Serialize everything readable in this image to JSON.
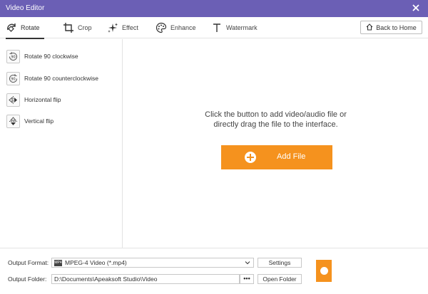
{
  "window": {
    "title": "Video Editor"
  },
  "tabs": [
    {
      "label": "Rotate",
      "icon": "rotate-icon",
      "active": true
    },
    {
      "label": "Crop",
      "icon": "crop-icon",
      "active": false
    },
    {
      "label": "Effect",
      "icon": "effect-sparkle-icon",
      "active": false
    },
    {
      "label": "Enhance",
      "icon": "enhance-palette-icon",
      "active": false
    },
    {
      "label": "Watermark",
      "icon": "text-t-icon",
      "active": false
    }
  ],
  "back_home": {
    "label": "Back to Home",
    "icon": "home-icon"
  },
  "sidebar": {
    "items": [
      {
        "label": "Rotate 90 clockwise",
        "icon": "rotate-clockwise-icon",
        "badge": "90"
      },
      {
        "label": "Rotate 90 counterclockwise",
        "icon": "rotate-counterclockwise-icon",
        "badge": "90"
      },
      {
        "label": "Horizontal flip",
        "icon": "horizontal-flip-icon"
      },
      {
        "label": "Vertical flip",
        "icon": "vertical-flip-icon"
      }
    ]
  },
  "main": {
    "hint_line1": "Click the button to add video/audio file or",
    "hint_line2": "directly drag the file to the interface.",
    "add_file_label": "Add File"
  },
  "bottom": {
    "output_format_label": "Output Format:",
    "output_format_value": "MPEG-4 Video (*.mp4)",
    "output_format_icon_text": "MP4",
    "settings_label": "Settings",
    "output_folder_label": "Output Folder:",
    "output_folder_value": "D:\\Documents\\Apeaksoft Studio\\Video",
    "browse_label": "•••",
    "open_folder_label": "Open Folder"
  },
  "colors": {
    "titlebar": "#6b5fb5",
    "accent": "#f5921e"
  }
}
